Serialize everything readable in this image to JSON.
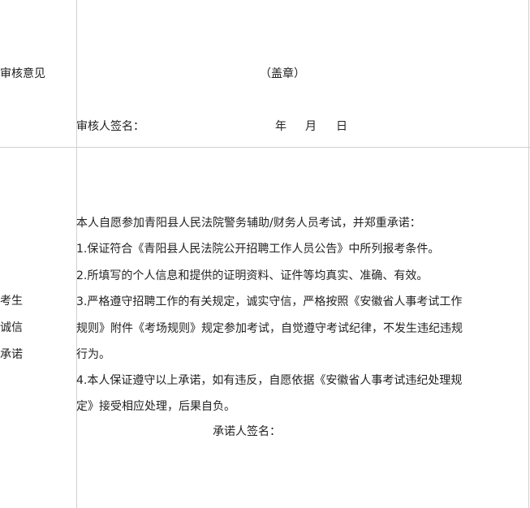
{
  "review_section": {
    "label": "审核意见",
    "stamp": "（盖章）",
    "signer_label": "审核人签名：",
    "date_year": "年",
    "date_month": "月",
    "date_day": "日"
  },
  "pledge_section": {
    "label_lines": [
      "考生",
      "诚信",
      "承诺"
    ],
    "intro": "本人自愿参加青阳县人民法院警务辅助/财务人员考试，并郑重承诺：",
    "lines": [
      "1.保证符合《青阳县人民法院公开招聘工作人员公告》中所列报考条件。",
      "2.所填写的个人信息和提供的证明资料、证件等均真实、准确、有效。",
      "3.严格遵守招聘工作的有关规定，诚实守信，严格按照《安徽省人事考试工作",
      "规则》附件《考场规则》规定参加考试，自觉遵守考试纪律，不发生违纪违规",
      "行为。",
      "4.本人保证遵守以上承诺，如有违反，自愿依据《安徽省人事考试违纪处理规",
      "定》接受相应处理，后果自负。"
    ],
    "signer_label": "承诺人签名："
  }
}
